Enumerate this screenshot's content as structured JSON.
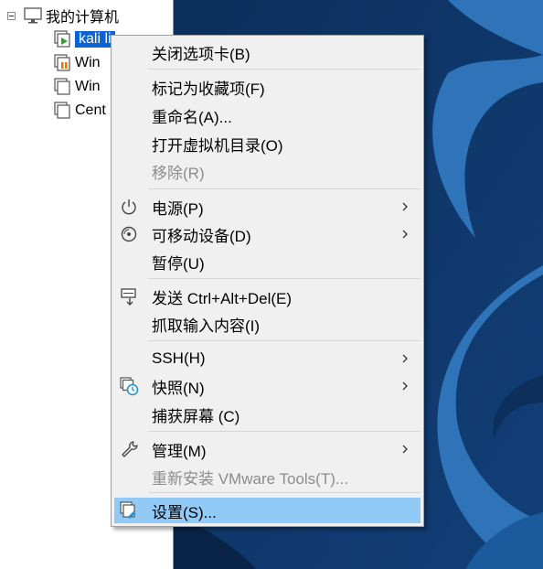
{
  "tree": {
    "root_label": "我的计算机",
    "items": [
      {
        "label": "kali li",
        "state": "running"
      },
      {
        "label": "Win",
        "state": "suspended"
      },
      {
        "label": "Win",
        "state": "off"
      },
      {
        "label": "Cent",
        "state": "off"
      }
    ]
  },
  "menu": {
    "close_tab": "关闭选项卡(B)",
    "mark_favorite": "标记为收藏项(F)",
    "rename": "重命名(A)...",
    "open_vm_dir": "打开虚拟机目录(O)",
    "remove": "移除(R)",
    "power": "电源(P)",
    "removable_devices": "可移动设备(D)",
    "pause": "暂停(U)",
    "send_ctrl_alt_del": "发送 Ctrl+Alt+Del(E)",
    "grab_input": "抓取输入内容(I)",
    "ssh": "SSH(H)",
    "snapshot": "快照(N)",
    "capture_screen": "捕获屏幕 (C)",
    "manage": "管理(M)",
    "reinstall_tools": "重新安装 VMware Tools(T)...",
    "settings": "设置(S)..."
  },
  "colors": {
    "selection": "#0a64d6",
    "menu_highlight": "#91c9f7",
    "wallpaper_dark": "#0f3a6e",
    "wallpaper_light": "#2f73b8"
  }
}
